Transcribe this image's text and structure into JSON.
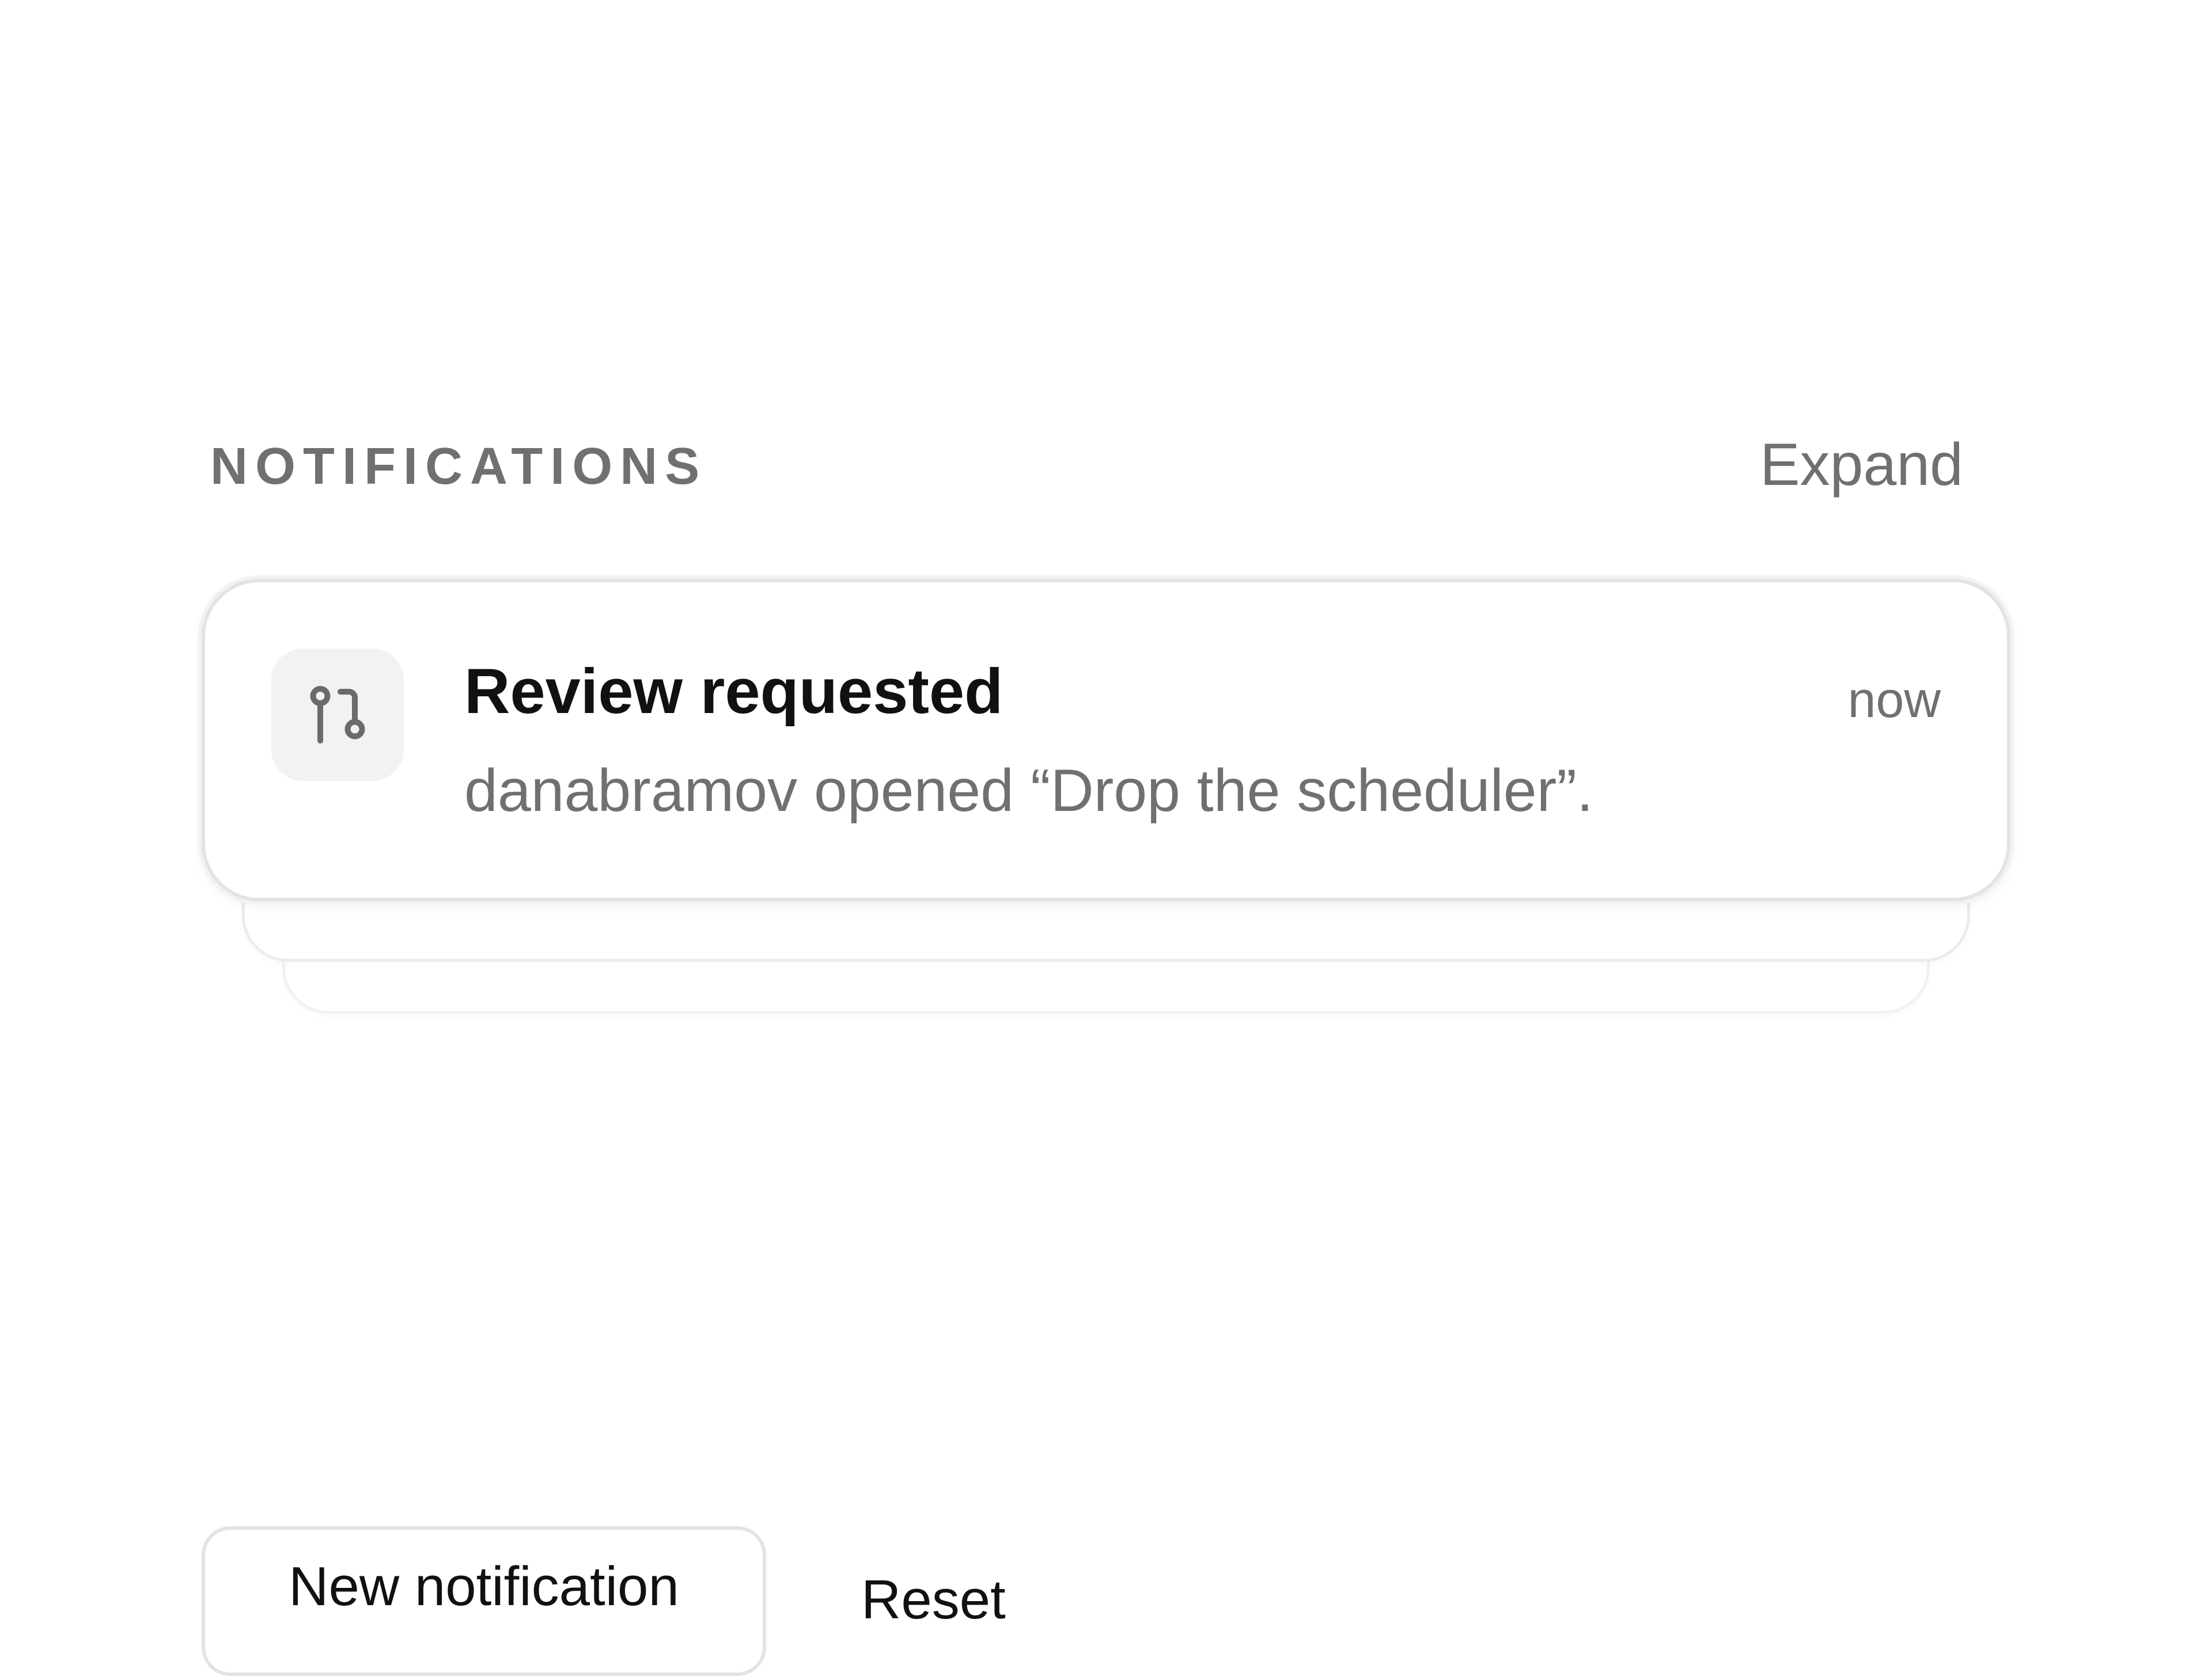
{
  "header": {
    "title": "NOTIFICATIONS",
    "expand_label": "Expand"
  },
  "notification": {
    "icon": "git-pull-request-icon",
    "title": "Review requested",
    "time": "now",
    "body": "danabramov opened “Drop the scheduler”."
  },
  "actions": {
    "new_label": "New notification",
    "reset_label": "Reset"
  }
}
